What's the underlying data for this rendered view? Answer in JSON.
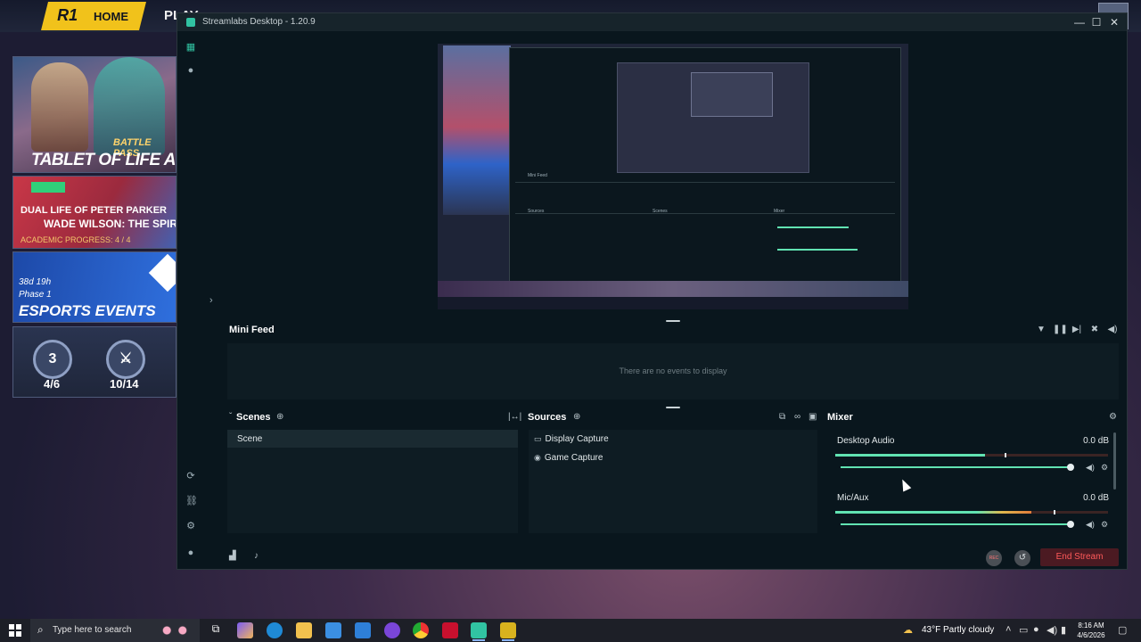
{
  "game": {
    "home_label": "HOME",
    "play_label": "PLAY",
    "card1": {
      "battle_pass": "BATTLE PASS",
      "title": "TABLET OF LIFE AND"
    },
    "card2": {
      "line1": "DUAL LIFE OF PETER PARKER",
      "line2": "WADE WILSON: THE SPIRIT SQUAD",
      "progress": "ACADEMIC PROGRESS: 4 / 4"
    },
    "card3": {
      "timer": "38d 19h",
      "phase": "Phase 1",
      "title": "ESPORTS EVENTS"
    },
    "card4": {
      "count1": "4/6",
      "count2": "10/14",
      "icon1_text": "3"
    }
  },
  "window": {
    "title": "Streamlabs Desktop - 1.20.9",
    "minimize": "—",
    "maximize": "☐",
    "close": "✕"
  },
  "mini_feed": {
    "title": "Mini Feed",
    "empty_text": "There are no events to display",
    "icons": [
      "filter-icon",
      "pause-icon",
      "skip-icon",
      "settings-icon",
      "volume-icon"
    ]
  },
  "scenes": {
    "title": "Scenes",
    "items": [
      {
        "label": "Scene",
        "selected": true
      }
    ]
  },
  "sources": {
    "title": "Sources",
    "items": [
      {
        "label": "Display Capture",
        "icon": "monitor-icon"
      },
      {
        "label": "Game Capture",
        "icon": "gamepad-icon"
      }
    ]
  },
  "mixer": {
    "title": "Mixer",
    "channels": [
      {
        "name": "Desktop Audio",
        "db": "0.0 dB",
        "level": 0.55,
        "peak": 0.62,
        "volume": 1.0
      },
      {
        "name": "Mic/Aux",
        "db": "0.0 dB",
        "level": 0.72,
        "peak": 0.8,
        "volume": 1.0
      }
    ]
  },
  "footer": {
    "rec_label": "REC",
    "end_stream_label": "End Stream"
  },
  "taskbar": {
    "search_placeholder": "Type here to search",
    "weather": "43°F  Partly cloudy",
    "time": "8:16 AM",
    "date": "4/6/2026"
  },
  "colors": {
    "accent": "#61e3b2",
    "end_stream_bg": "#4b1a22",
    "end_stream_text": "#ff5a5a",
    "panel_bg": "#0e1c23",
    "window_bg": "#09161d"
  }
}
